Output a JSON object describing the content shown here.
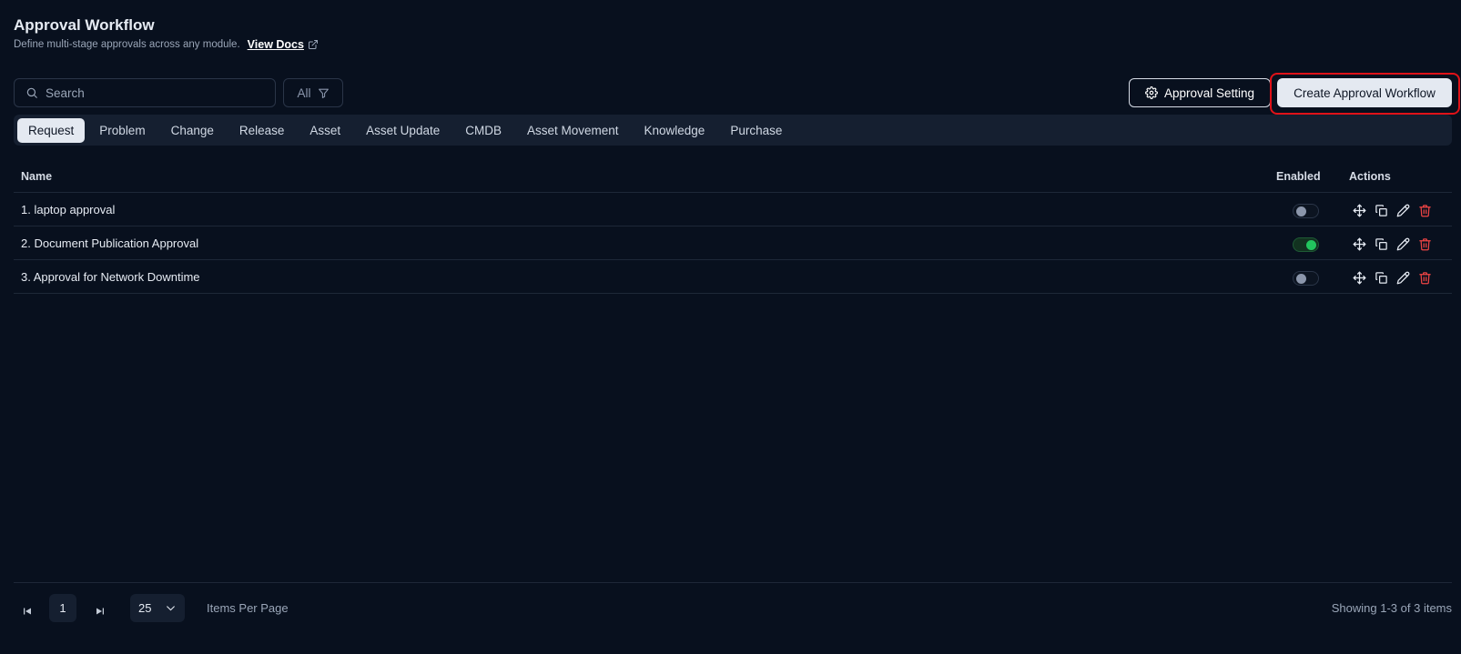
{
  "header": {
    "title": "Approval Workflow",
    "subtitle": "Define multi-stage approvals across any module.",
    "docs_link": "View Docs"
  },
  "toolbar": {
    "search_placeholder": "Search",
    "filter_label": "All",
    "setting_label": "Approval Setting",
    "create_label": "Create Approval Workflow"
  },
  "tabs": [
    {
      "label": "Request",
      "active": true
    },
    {
      "label": "Problem"
    },
    {
      "label": "Change"
    },
    {
      "label": "Release"
    },
    {
      "label": "Asset"
    },
    {
      "label": "Asset Update"
    },
    {
      "label": "CMDB"
    },
    {
      "label": "Asset Movement"
    },
    {
      "label": "Knowledge"
    },
    {
      "label": "Purchase"
    }
  ],
  "table": {
    "headers": {
      "name": "Name",
      "enabled": "Enabled",
      "actions": "Actions"
    },
    "rows": [
      {
        "name": "1. laptop approval",
        "enabled": false
      },
      {
        "name": "2. Document Publication Approval",
        "enabled": true
      },
      {
        "name": "3. Approval for Network Downtime",
        "enabled": false
      }
    ],
    "action_icons": [
      "move-icon",
      "duplicate-icon",
      "edit-icon",
      "delete-icon"
    ]
  },
  "pagination": {
    "current_page": "1",
    "per_page": "25",
    "per_page_label": "Items Per Page",
    "showing": "Showing 1-3 of 3 items"
  },
  "colors": {
    "background": "#08101e",
    "tab_bar": "#151f30",
    "primary_button": "#e4e9f1",
    "highlight_border": "#e01218",
    "toggle_on": "#22c55e",
    "delete": "#ef4444"
  }
}
